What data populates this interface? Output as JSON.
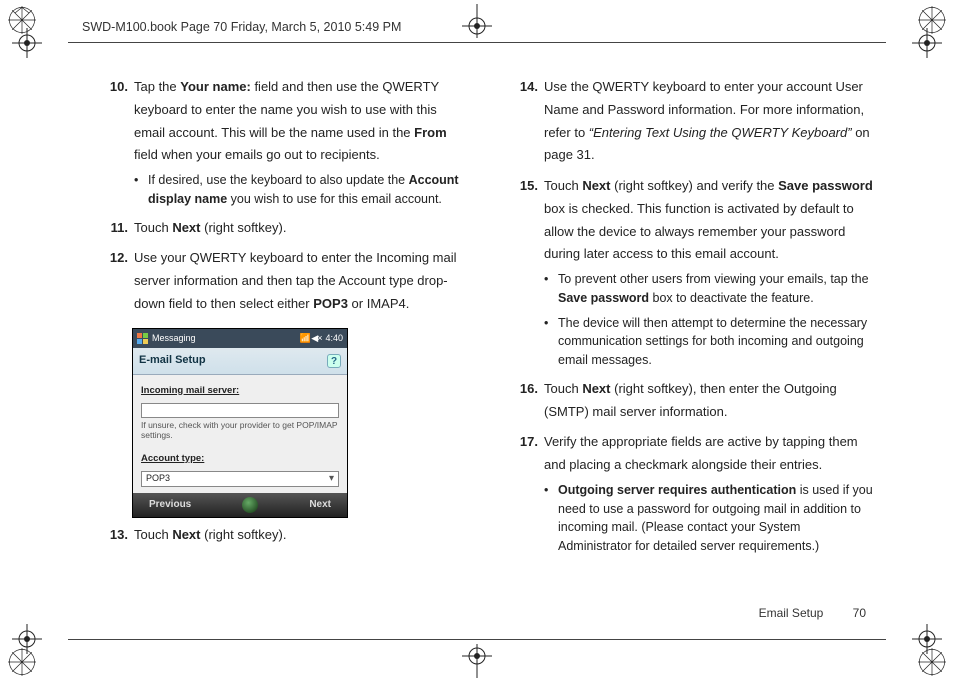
{
  "header": "SWD-M100.book  Page 70  Friday, March 5, 2010  5:49 PM",
  "footer": {
    "section": "Email Setup",
    "page": "70"
  },
  "left": {
    "s10": {
      "num": "10.",
      "t1": "Tap the ",
      "b1": "Your name:",
      "t2": " field and then use the QWERTY keyboard to enter the name you wish to use with this email account. This will be the name used in the ",
      "b2": "From",
      "t3": " field when your emails go out to recipients.",
      "bullet_t1": "If desired, use the keyboard to also update the ",
      "bullet_b1": "Account display name",
      "bullet_t2": " you wish to use for this email account."
    },
    "s11": {
      "num": "11.",
      "t1": "Touch ",
      "b1": "Next",
      "t2": " (right softkey)."
    },
    "s12": {
      "num": "12.",
      "t1": "Use your QWERTY keyboard to enter the Incoming mail server information and then tap the Account type drop-down field to then select either ",
      "b1": "POP3",
      "t2": " or IMAP4."
    },
    "s13": {
      "num": "13.",
      "t1": "Touch ",
      "b1": "Next",
      "t2": " (right softkey)."
    }
  },
  "screenshot": {
    "title": "Messaging",
    "clock": "4:40",
    "heading": "E-mail Setup",
    "incoming_label": "Incoming mail server:",
    "incoming_value": "",
    "hint": "If unsure, check with your provider to get POP/IMAP settings.",
    "account_type_label": "Account type:",
    "account_type_value": "POP3",
    "previous": "Previous",
    "next": "Next"
  },
  "right": {
    "s14": {
      "num": "14.",
      "t1": "Use the QWERTY keyboard to enter your account User Name and Password information. For more information, refer to ",
      "i1": "“Entering Text Using the QWERTY Keyboard”",
      "t2": "  on page 31."
    },
    "s15": {
      "num": "15.",
      "t1": "Touch ",
      "b1": "Next",
      "t2": " (right softkey) and verify the ",
      "b2": "Save password",
      "t3": " box is checked. This function is activated by default to allow the device to always remember your password during later access to this email account.",
      "bul1_t1": "To prevent other users from viewing your emails, tap the ",
      "bul1_b1": "Save password",
      "bul1_t2": " box to deactivate the feature.",
      "bul2": "The device will then attempt to determine the necessary communication settings for both incoming and outgoing email messages."
    },
    "s16": {
      "num": "16.",
      "t1": "Touch ",
      "b1": "Next",
      "t2": " (right softkey), then enter the Outgoing (SMTP) mail server information."
    },
    "s17": {
      "num": "17.",
      "t1": "Verify the appropriate fields are active by tapping them and placing a checkmark alongside their entries.",
      "bul_b1": "Outgoing server requires authentication",
      "bul_t1": " is used if you need to use a password for outgoing mail in addition to incoming mail. (Please contact your System Administrator for detailed server requirements.)"
    }
  }
}
